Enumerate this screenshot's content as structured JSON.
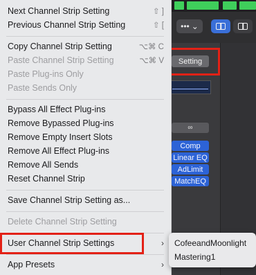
{
  "background": {
    "setting_button_label": "Setting",
    "more_button_glyph": "•••",
    "more_button_chevron": "⌄",
    "link_button_glyph": "∞",
    "plugins": [
      "Comp",
      "Linear EQ",
      "AdLimit",
      "MatchEQ"
    ]
  },
  "menu": {
    "items": [
      {
        "label": "Next Channel Strip Setting",
        "shortcut": "⇧ ]"
      },
      {
        "label": "Previous Channel Strip Setting",
        "shortcut": "⇧ ["
      },
      {
        "label": "Copy Channel Strip Setting",
        "shortcut": "⌥⌘ C"
      },
      {
        "label": "Paste Channel Strip Setting",
        "shortcut": "⌥⌘ V"
      },
      {
        "label": "Paste Plug-ins Only"
      },
      {
        "label": "Paste Sends Only"
      },
      {
        "label": "Bypass All Effect Plug-ins"
      },
      {
        "label": "Remove Bypassed Plug-ins"
      },
      {
        "label": "Remove Empty Insert Slots"
      },
      {
        "label": "Remove All Effect Plug-ins"
      },
      {
        "label": "Remove All Sends"
      },
      {
        "label": "Reset Channel Strip"
      },
      {
        "label": "Save Channel Strip Setting as..."
      },
      {
        "label": "Delete Channel Strip Setting"
      },
      {
        "label": "User Channel Strip Settings",
        "arrow": "›"
      },
      {
        "label": "App Presets",
        "arrow": "›"
      }
    ]
  },
  "submenu": {
    "items": [
      "CofeeandMoonlight",
      "Mastering1"
    ]
  },
  "colors": {
    "highlight_outline": "#e32116",
    "plugin_blue": "#2d63d6",
    "meter_green": "#3fcf5b"
  }
}
